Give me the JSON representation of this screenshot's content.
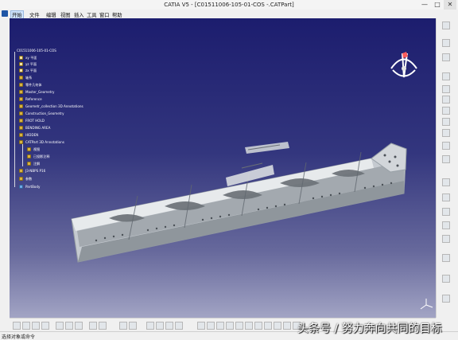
{
  "window": {
    "title": "CATIA V5 - [C01511006-105-01-COS -.CATPart]",
    "controls": [
      "—",
      "□",
      "✕"
    ]
  },
  "menu": [
    {
      "label": "开始",
      "active": true
    },
    {
      "label": "文件"
    },
    {
      "label": "编辑"
    },
    {
      "label": "视图"
    },
    {
      "label": "插入"
    },
    {
      "label": "工具"
    },
    {
      "label": "窗口"
    },
    {
      "label": "帮助"
    }
  ],
  "tree": {
    "root": "C01511006-105-01-COS",
    "items": [
      {
        "label": "xy 平面",
        "icon": "plane"
      },
      {
        "label": "yz 平面",
        "icon": "plane"
      },
      {
        "label": "zx 平面",
        "icon": "plane"
      },
      {
        "label": "轴系",
        "icon": "folder"
      },
      {
        "label": "零件几何体",
        "icon": "folder"
      },
      {
        "label": "Master_Geometry",
        "icon": "folder"
      },
      {
        "label": "Reference",
        "icon": "folder"
      },
      {
        "label": "Geometr_collection 3D Annotations",
        "icon": "folder"
      },
      {
        "label": "Construction_Geometry",
        "icon": "folder"
      },
      {
        "label": "FROT HOLD",
        "icon": "folder"
      },
      {
        "label": "BENDING AREA",
        "icon": "folder"
      },
      {
        "label": "HIDDEN",
        "icon": "folder"
      },
      {
        "label": "CATPart 3D Annotations",
        "icon": "folder"
      },
      {
        "label": "视图",
        "icon": "folder"
      },
      {
        "label": "已投影注释",
        "icon": "folder"
      },
      {
        "label": "注解",
        "icon": "folder"
      },
      {
        "label": "J3-NBPS P16",
        "icon": "folder"
      },
      {
        "label": "参数",
        "icon": "folder"
      },
      {
        "label": "PartBody",
        "icon": "body"
      }
    ]
  },
  "status": {
    "text": "选择对象或命令"
  },
  "watermark": {
    "text": "头条号 / 努力奔向共同的目标"
  },
  "colors": {
    "viewport_top": "#1c1d6e",
    "viewport_bottom": "#a2a4c4",
    "part_metal": "#c7ccd1",
    "part_shadow": "#8d949a"
  }
}
